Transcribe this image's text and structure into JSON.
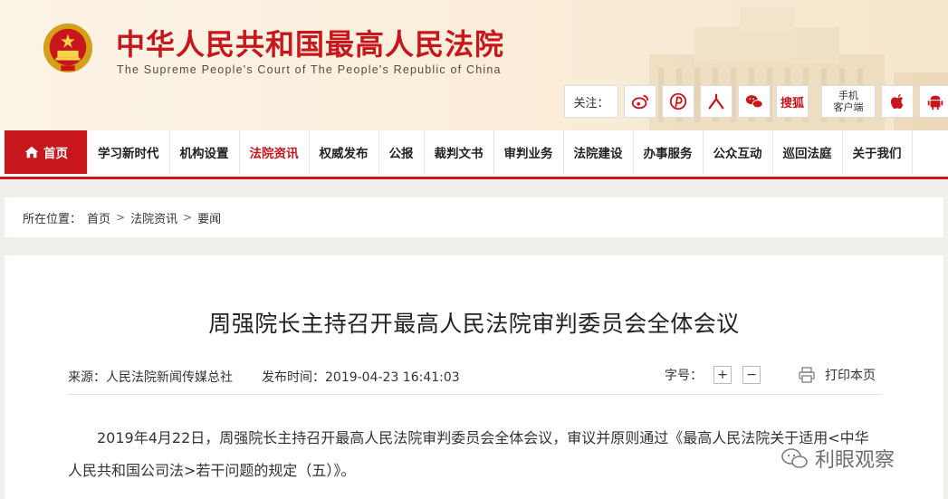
{
  "header": {
    "title": "中华人民共和国最高人民法院",
    "subtitle": "The Supreme People's Court of The People's Republic of China",
    "follow_label": "关注：",
    "sousuo_label": "搜狐",
    "mobile_label_line1": "手机",
    "mobile_label_line2": "客户端",
    "accent": "#c8161d"
  },
  "nav": {
    "items": [
      {
        "label": "首页"
      },
      {
        "label": "学习新时代"
      },
      {
        "label": "机构设置"
      },
      {
        "label": "法院资讯"
      },
      {
        "label": "权威发布"
      },
      {
        "label": "公报"
      },
      {
        "label": "裁判文书"
      },
      {
        "label": "审判业务"
      },
      {
        "label": "法院建设"
      },
      {
        "label": "办事服务"
      },
      {
        "label": "公众互动"
      },
      {
        "label": "巡回法庭"
      },
      {
        "label": "关于我们"
      }
    ],
    "active_index": 3
  },
  "breadcrumb": {
    "prefix": "所在位置：",
    "items": [
      "首页",
      "法院资讯",
      "要闻"
    ],
    "separator": ">"
  },
  "article": {
    "title": "周强院长主持召开最高人民法院审判委员会全体会议",
    "source": "来源：人民法院新闻传媒总社",
    "date": "发布时间：2019-04-23 16:41:03",
    "font_size_label": "字号：",
    "font_plus": "+",
    "font_minus": "−",
    "print_label": "打印本页",
    "body": "2019年4月22日，周强院长主持召开最高人民法院审判委员会全体会议，审议并原则通过《最高人民法院关于适用<中华人民共和国公司法>若干问题的规定（五）》。"
  },
  "watermark": {
    "text": "利眼观察"
  }
}
